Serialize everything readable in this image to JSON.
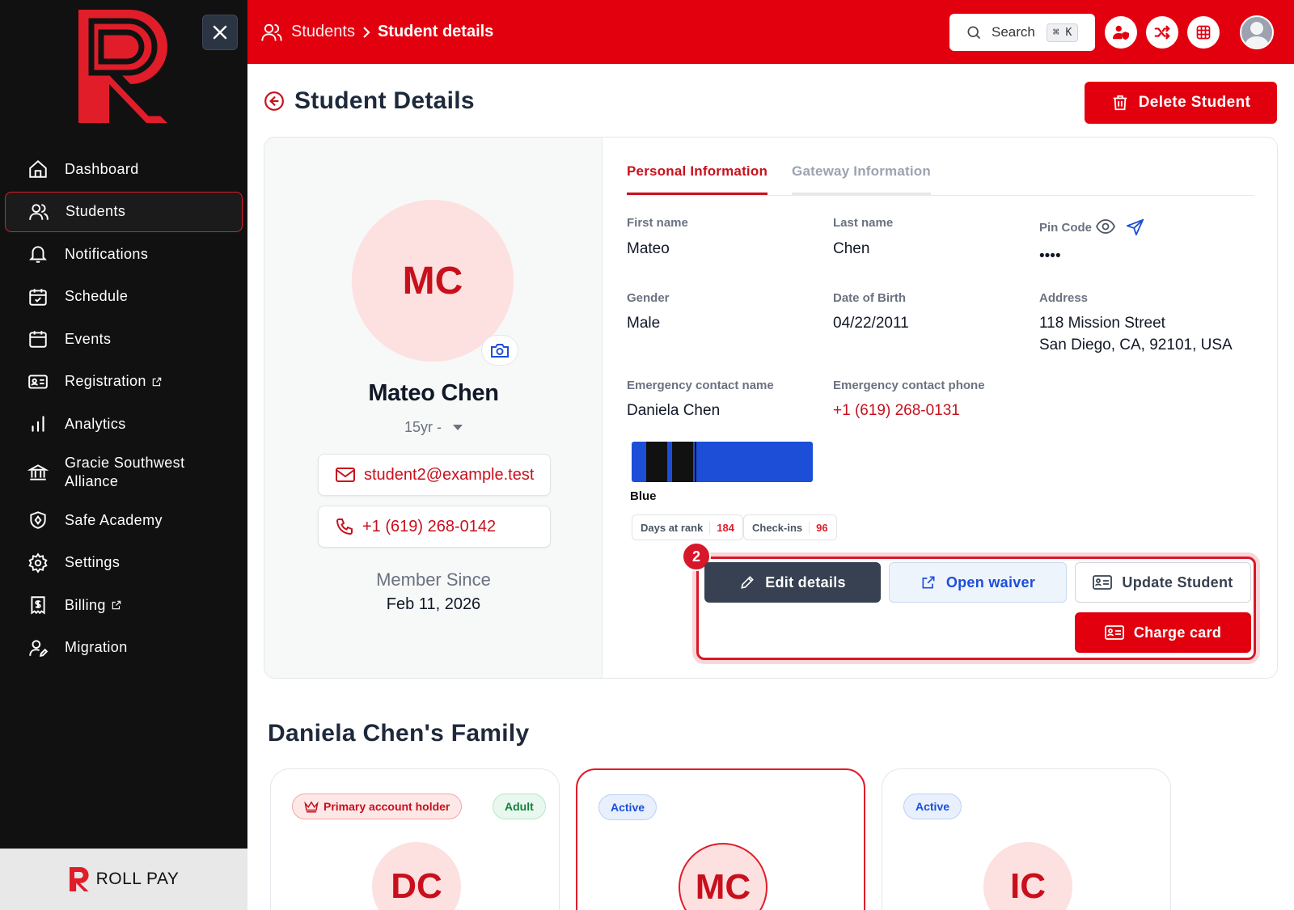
{
  "sidebar": {
    "items": [
      {
        "label": "Dashboard",
        "icon": "home-icon"
      },
      {
        "label": "Students",
        "icon": "users-icon"
      },
      {
        "label": "Notifications",
        "icon": "bell-icon"
      },
      {
        "label": "Schedule",
        "icon": "calendar-check-icon"
      },
      {
        "label": "Events",
        "icon": "calendar-icon"
      },
      {
        "label": "Registration",
        "icon": "id-card-icon"
      },
      {
        "label": "Analytics",
        "icon": "bar-chart-icon"
      },
      {
        "label": "Gracie Southwest Alliance",
        "icon": "bank-icon"
      },
      {
        "label": "Safe Academy",
        "icon": "shield-icon"
      },
      {
        "label": "Settings",
        "icon": "gear-icon"
      },
      {
        "label": "Billing",
        "icon": "receipt-icon"
      },
      {
        "label": "Migration",
        "icon": "user-edit-icon"
      }
    ],
    "footer_brand": "ROLL PAY"
  },
  "topbar": {
    "crumb_parent": "Students",
    "crumb_current": "Student details",
    "search_label": "Search",
    "search_shortcut": "⌘ K"
  },
  "page": {
    "title": "Student Details",
    "delete_label": "Delete Student"
  },
  "student": {
    "initials": "MC",
    "name": "Mateo Chen",
    "age": "15yr -",
    "email": "student2@example.test",
    "phone": "+1 (619) 268-0142",
    "member_since_label": "Member Since",
    "member_since": "Feb 11, 2026"
  },
  "tabs": [
    {
      "label": "Personal Information"
    },
    {
      "label": "Gateway Information"
    }
  ],
  "fields": {
    "first_name_label": "First name",
    "first_name": "Mateo",
    "last_name_label": "Last name",
    "last_name": "Chen",
    "pin_label": "Pin Code",
    "pin": "••••",
    "gender_label": "Gender",
    "gender": "Male",
    "dob_label": "Date of Birth",
    "dob": "04/22/2011",
    "address_label": "Address",
    "address_line1": "118 Mission Street",
    "address_line2": "San Diego, CA, 92101, USA",
    "ec_name_label": "Emergency contact name",
    "ec_name": "Daniela Chen",
    "ec_phone_label": "Emergency contact phone",
    "ec_phone": "+1 (619) 268-0131"
  },
  "rank": {
    "belt_name": "Blue",
    "belt_color": "#1d4ed8",
    "days_label": "Days at rank",
    "days": "184",
    "checkins_label": "Check-ins",
    "checkins": "96"
  },
  "actions": {
    "step_badge": "2",
    "edit": "Edit details",
    "waiver": "Open waiver",
    "update": "Update Student",
    "charge": "Charge card"
  },
  "family": {
    "title": "Daniela Chen's Family",
    "members": [
      {
        "initials": "DC",
        "tag1": "Primary account holder",
        "tag2": "Adult"
      },
      {
        "initials": "MC",
        "tag1": "Active"
      },
      {
        "initials": "IC",
        "tag1": "Active"
      }
    ]
  },
  "colors": {
    "brand": "#e2000f",
    "sidebar": "#111111",
    "accent_blue": "#1d4ed8"
  }
}
